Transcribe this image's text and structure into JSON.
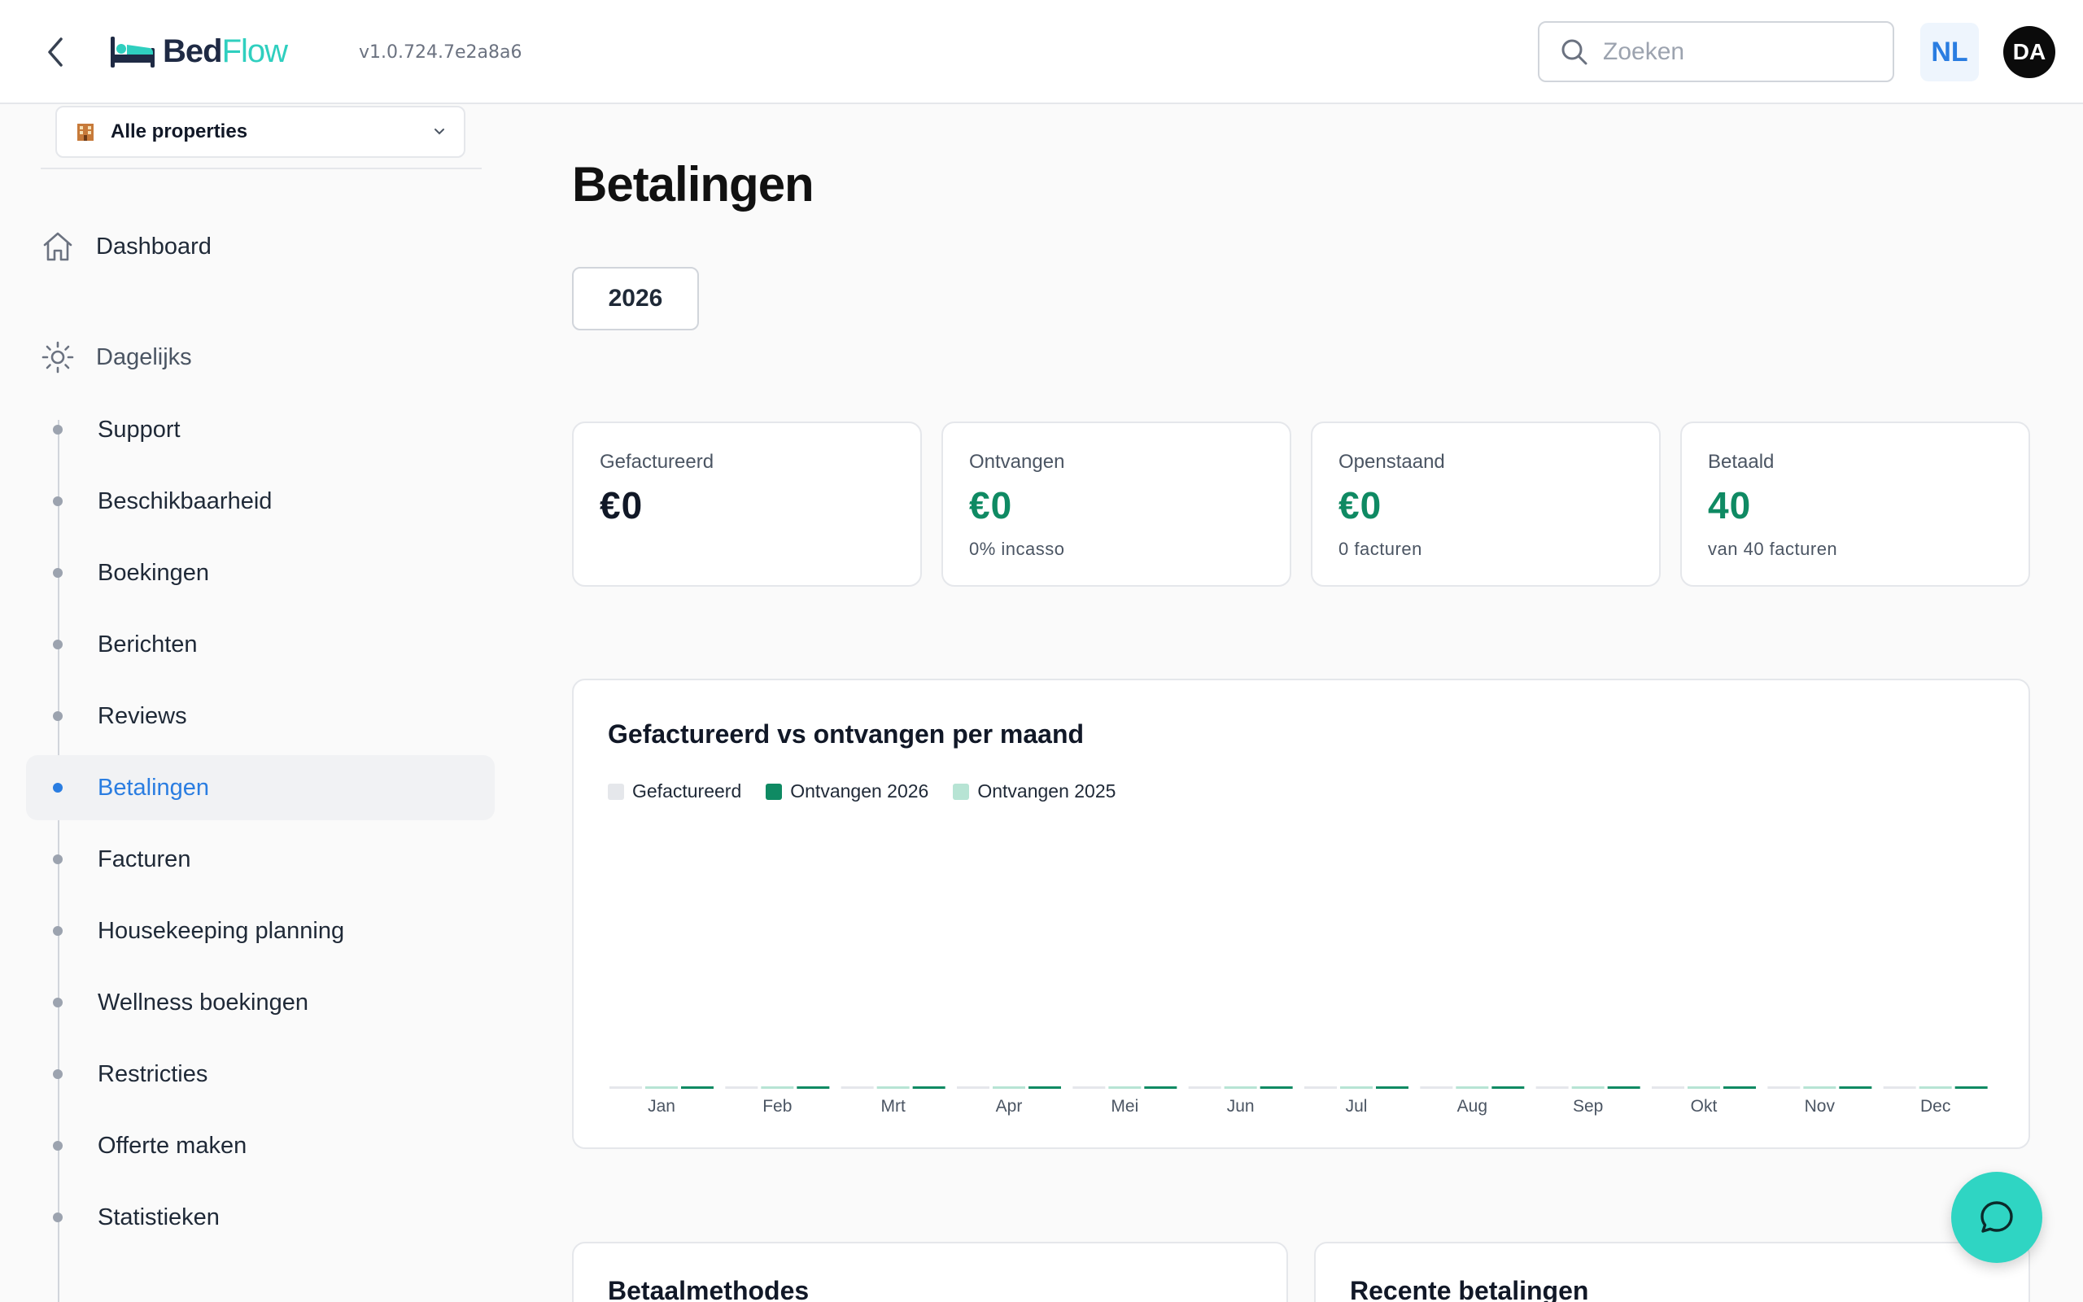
{
  "header": {
    "logo": {
      "part1": "Bed",
      "part2": "Flow"
    },
    "version": "v1.0.724.7e2a8a6",
    "search_placeholder": "Zoeken",
    "language": "NL",
    "user_initials": "DA"
  },
  "sidebar": {
    "property_select": "Alle properties",
    "dashboard": "Dashboard",
    "daily_section": "Dagelijks",
    "items": [
      {
        "label": "Support",
        "active": false
      },
      {
        "label": "Beschikbaarheid",
        "active": false
      },
      {
        "label": "Boekingen",
        "active": false
      },
      {
        "label": "Berichten",
        "active": false
      },
      {
        "label": "Reviews",
        "active": false
      },
      {
        "label": "Betalingen",
        "active": true
      },
      {
        "label": "Facturen",
        "active": false
      },
      {
        "label": "Housekeeping planning",
        "active": false
      },
      {
        "label": "Wellness boekingen",
        "active": false
      },
      {
        "label": "Restricties",
        "active": false
      },
      {
        "label": "Offerte maken",
        "active": false
      },
      {
        "label": "Statistieken",
        "active": false
      }
    ]
  },
  "main": {
    "title": "Betalingen",
    "year": "2026",
    "stats": [
      {
        "label": "Gefactureerd",
        "value": "€0",
        "sub": "",
        "color": "#111827"
      },
      {
        "label": "Ontvangen",
        "value": "€0",
        "sub": "0% incasso",
        "color": "#0f8a63"
      },
      {
        "label": "Openstaand",
        "value": "€0",
        "sub": "0 facturen",
        "color": "#0f8a63"
      },
      {
        "label": "Betaald",
        "value": "40",
        "sub": "van 40 facturen",
        "color": "#0f8a63"
      }
    ],
    "bottom_cards": {
      "left_title": "Betaalmethodes",
      "right_title": "Recente betalingen"
    }
  },
  "chart_data": {
    "type": "bar",
    "title": "Gefactureerd vs ontvangen per maand",
    "categories": [
      "Jan",
      "Feb",
      "Mrt",
      "Apr",
      "Mei",
      "Jun",
      "Jul",
      "Aug",
      "Sep",
      "Okt",
      "Nov",
      "Dec"
    ],
    "series": [
      {
        "name": "Gefactureerd",
        "color": "#e5e7eb",
        "values": [
          0,
          0,
          0,
          0,
          0,
          0,
          0,
          0,
          0,
          0,
          0,
          0
        ]
      },
      {
        "name": "Ontvangen 2026",
        "color": "#0f8a63",
        "values": [
          0,
          0,
          0,
          0,
          0,
          0,
          0,
          0,
          0,
          0,
          0,
          0
        ]
      },
      {
        "name": "Ontvangen 2025",
        "color": "#b7e4d4",
        "values": [
          0,
          0,
          0,
          0,
          0,
          0,
          0,
          0,
          0,
          0,
          0,
          0
        ]
      }
    ],
    "grid": false,
    "legend_position": "top-left"
  }
}
